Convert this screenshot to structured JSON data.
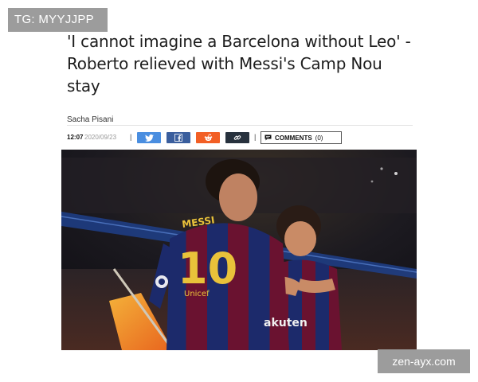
{
  "overlay": {
    "tg_handle": "TG: MYYJJPP",
    "watermark": "zen-ayx.com"
  },
  "article": {
    "headline": "'I cannot imagine a Barcelona without Leo' - Roberto relieved with Messi's Camp Nou stay",
    "author": "Sacha Pisani",
    "time": "12:07",
    "date": "2020/09/23",
    "separator": "|"
  },
  "share_bar": {
    "buttons": [
      {
        "network": "twitter",
        "icon": "twitter-bird-icon",
        "color": "#4a8ee0"
      },
      {
        "network": "facebook",
        "icon": "facebook-f-icon",
        "color": "#3a5e9d"
      },
      {
        "network": "reddit",
        "icon": "reddit-alien-icon",
        "color": "#f25f25"
      },
      {
        "network": "link",
        "icon": "link-icon",
        "color": "#27313d"
      }
    ],
    "comments_label": "COMMENTS",
    "comments_count": "(0)"
  },
  "photo": {
    "jersey_name": "MESSI",
    "jersey_number": "10",
    "sponsor_main": "Unicef",
    "sponsor_rakuten": "akuten"
  }
}
